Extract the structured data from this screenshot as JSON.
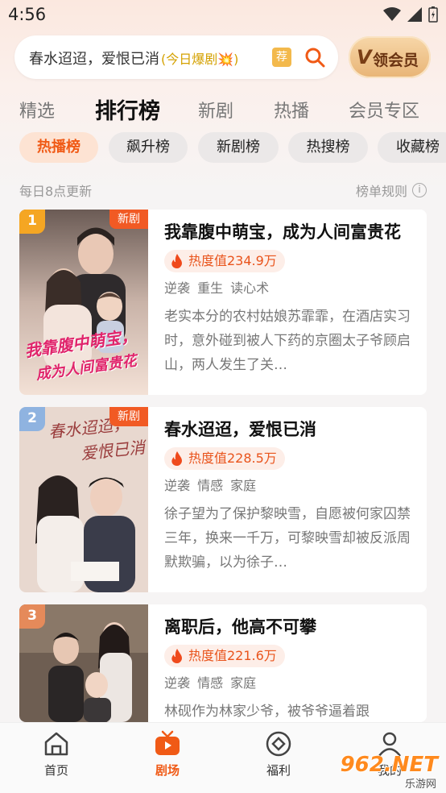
{
  "status_bar": {
    "time": "4:56"
  },
  "search": {
    "query": "春水迢迢，爱恨已消",
    "hot_label": "(今日爆剧💥)",
    "rec_badge": "荐"
  },
  "vip_button": {
    "icon_letter": "V",
    "label": "领会员"
  },
  "tabs": [
    {
      "label": "精选"
    },
    {
      "label": "排行榜",
      "active": true
    },
    {
      "label": "新剧"
    },
    {
      "label": "热播"
    },
    {
      "label": "会员专区"
    }
  ],
  "chips": [
    {
      "label": "热播榜",
      "active": true
    },
    {
      "label": "飙升榜"
    },
    {
      "label": "新剧榜"
    },
    {
      "label": "热搜榜"
    },
    {
      "label": "收藏榜"
    }
  ],
  "list_header": {
    "update_note": "每日8点更新",
    "rules_label": "榜单规则",
    "info_icon": "i"
  },
  "items": [
    {
      "rank": "1",
      "rank_color": "#f5a623",
      "new_tag": "新剧",
      "title": "我靠腹中萌宝，成为人间富贵花",
      "heat": "热度值234.9万",
      "tags": "逆袭 重生 读心术",
      "desc": "老实本分的农村姑娘苏霏霏，在酒店实习时，意外碰到被人下药的京圈太子爷顾启山，两人发生了关…",
      "cover_text_line1": "我靠腹中萌宝，",
      "cover_text_line2": "成为人间富贵花"
    },
    {
      "rank": "2",
      "rank_color": "#8fb3e0",
      "new_tag": "新剧",
      "title": "春水迢迢，爱恨已消",
      "heat": "热度值228.5万",
      "tags": "逆袭 情感 家庭",
      "desc": "徐子望为了保护黎映雪，自愿被何家囚禁三年，换来一千万，可黎映雪却被反派周默欺骗，以为徐子…",
      "cover_text_line1": "春水迢迢，",
      "cover_text_line2": "爱恨已消"
    },
    {
      "rank": "3",
      "rank_color": "#e58a5a",
      "new_tag": "",
      "title": "离职后，他高不可攀",
      "heat": "热度值221.6万",
      "tags": "逆袭 情感 家庭",
      "desc": "林砚作为林家少爷，被爷爷逼着跟",
      "cover_text_line1": "",
      "cover_text_line2": ""
    }
  ],
  "bottom_nav": [
    {
      "label": "首页",
      "icon": "home-icon"
    },
    {
      "label": "剧场",
      "icon": "tv-icon",
      "active": true
    },
    {
      "label": "福利",
      "icon": "coin-icon"
    },
    {
      "label": "我的",
      "icon": "user-icon"
    }
  ],
  "watermark": {
    "text": "962.NET",
    "subtext": "乐游网"
  }
}
